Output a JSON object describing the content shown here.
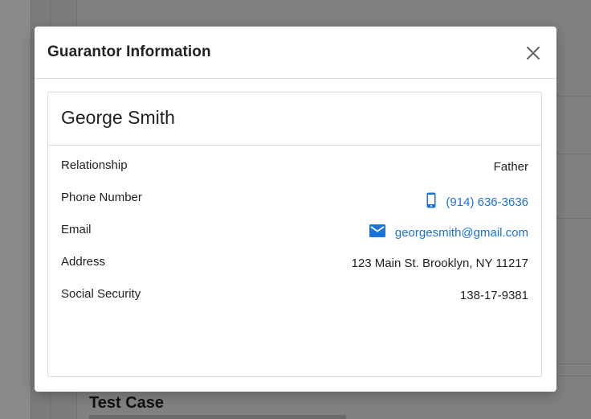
{
  "background": {
    "section_title": "Test Case"
  },
  "modal": {
    "title": "Guarantor Information",
    "close_icon": "close-icon",
    "guarantor_name": "George Smith",
    "fields": {
      "relationship": {
        "label": "Relationship",
        "value": "Father"
      },
      "phone": {
        "label": "Phone Number",
        "value": "(914) 636-3636",
        "icon": "mobile-phone-icon"
      },
      "email": {
        "label": "Email",
        "value": "georgesmith@gmail.com",
        "icon": "envelope-icon"
      },
      "address": {
        "label": "Address",
        "value": "123 Main St. Brooklyn, NY 11217"
      },
      "ssn": {
        "label": "Social Security",
        "value": "138-17-9381"
      }
    }
  },
  "colors": {
    "link": "#1a73d9",
    "overlay": "#808080"
  }
}
